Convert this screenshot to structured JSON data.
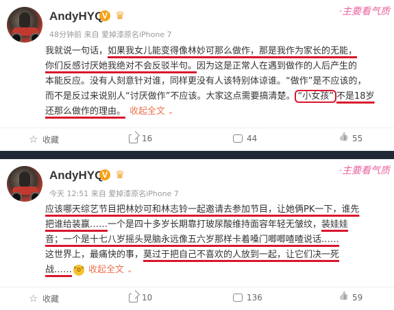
{
  "posts": [
    {
      "author": "AndyHYQ",
      "meta": "48分钟前 来自 爱掉漆原名iPhone 7",
      "watermark": "·主要看气质",
      "lines": [
        {
          "segments": [
            {
              "text": "我就说一句话，",
              "style": "plain"
            },
            {
              "text": "如果我女儿能变得像林妙可那么做作，那是我作为家长的无能，",
              "style": "underline"
            }
          ]
        },
        {
          "segments": [
            {
              "text": "你们反感讨厌她我绝对不会反驳半句。",
              "style": "underline"
            },
            {
              "text": "因为这是正常人在遇到做作的人后产生的",
              "style": "plain"
            }
          ]
        },
        {
          "segments": [
            {
              "text": "本能反应。没有人刻意针对谁，同样更没有人该特别体谅谁。“做作”是不应该的，",
              "style": "plain"
            }
          ]
        },
        {
          "segments": [
            {
              "text": "而不是反过来说别人“讨厌做作”不应该。大家这点需要搞清楚。",
              "style": "plain"
            },
            {
              "text": "“小女孩”",
              "style": "boxed"
            },
            {
              "text": "不是18岁",
              "style": "underline"
            }
          ]
        },
        {
          "segments": [
            {
              "text": "还那么做作的理由。",
              "style": "underline"
            }
          ]
        }
      ],
      "fold_label": "收起全文",
      "actions": {
        "favorite": "收藏",
        "share": "16",
        "comment": "44",
        "like": "55"
      }
    },
    {
      "author": "AndyHYQ",
      "meta": "今天 12:51 来自 爱掉漆原名iPhone 7",
      "watermark": "·主要看气质",
      "lines": [
        {
          "segments": [
            {
              "text": "应该哪天综艺节目把林妙可和林志铃一起邀请去参加节目，让她俩PK一下，谁先",
              "style": "underline"
            }
          ]
        },
        {
          "segments": [
            {
              "text": "把谁给装赢……",
              "style": "underline"
            },
            {
              "text": "一个是四十多岁长期靠打玻尿酸维持面容年轻无皱纹，",
              "style": "plain"
            },
            {
              "text": "装娃娃",
              "style": "underline"
            }
          ]
        },
        {
          "segments": [
            {
              "text": "音；",
              "style": "underline"
            },
            {
              "text": "一个是十七八岁摇头晃脑永远像五六岁那样卡着嗓门唧唧喳喳说话……",
              "style": "underline"
            }
          ]
        },
        {
          "segments": [
            {
              "text": "这世界上，最痛快的事，",
              "style": "plain"
            },
            {
              "text": "莫过于把自己不喜欢的人放到一起，让它们决一死",
              "style": "underline"
            }
          ]
        },
        {
          "segments": [
            {
              "text": "战……",
              "style": "underline"
            }
          ]
        }
      ],
      "fold_label": "收起全文",
      "actions": {
        "favorite": "收藏",
        "share": "10",
        "comment": "136",
        "like": "59"
      }
    }
  ]
}
